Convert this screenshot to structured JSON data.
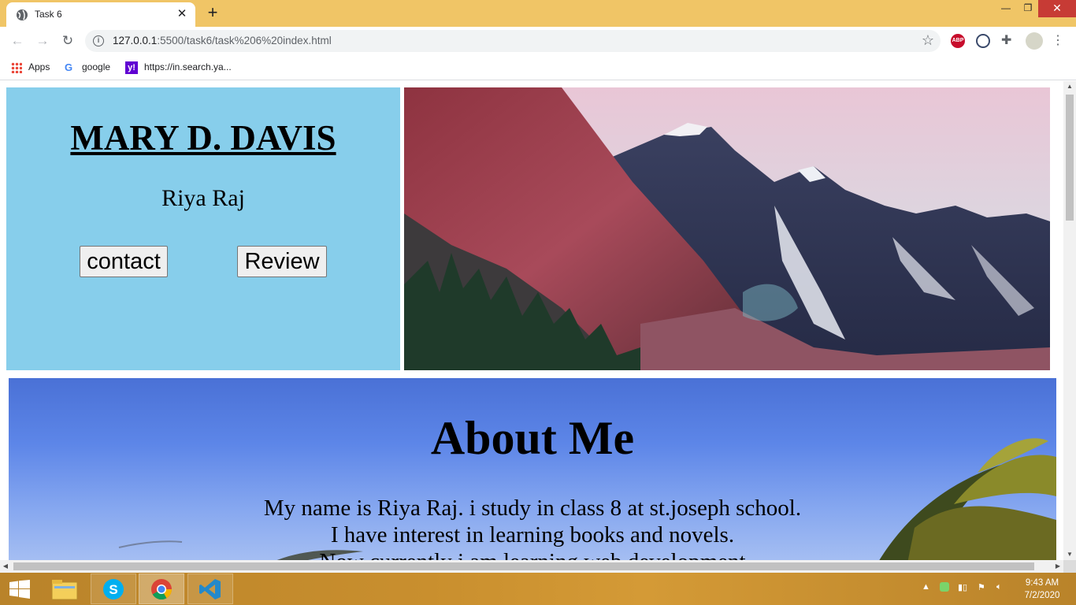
{
  "browser": {
    "tab_title": "Task 6",
    "url_host": "127.0.0.1",
    "url_path": ":5500/task6/task%206%20index.html"
  },
  "bookmarks": [
    {
      "label": "Apps",
      "icon": "apps-grid-icon"
    },
    {
      "label": "google",
      "icon": "google-icon"
    },
    {
      "label": "https://in.search.ya...",
      "icon": "yahoo-icon"
    }
  ],
  "hero": {
    "title": "MARY D. DAVIS",
    "subtitle": "Riya Raj",
    "contact_label": "contact",
    "review_label": "Review"
  },
  "about": {
    "heading": "About Me",
    "lines": [
      "My name is Riya Raj. i study in class 8 at st.joseph school.",
      "I have interest in learning books and novels.",
      "Now currently i am learning web development"
    ]
  },
  "taskbar": {
    "time": "9:43 AM",
    "date": "7/2/2020"
  },
  "colors": {
    "hero_bg": "#87ceeb",
    "titlebar": "#f0c566",
    "taskbar": "#c98f2e"
  }
}
